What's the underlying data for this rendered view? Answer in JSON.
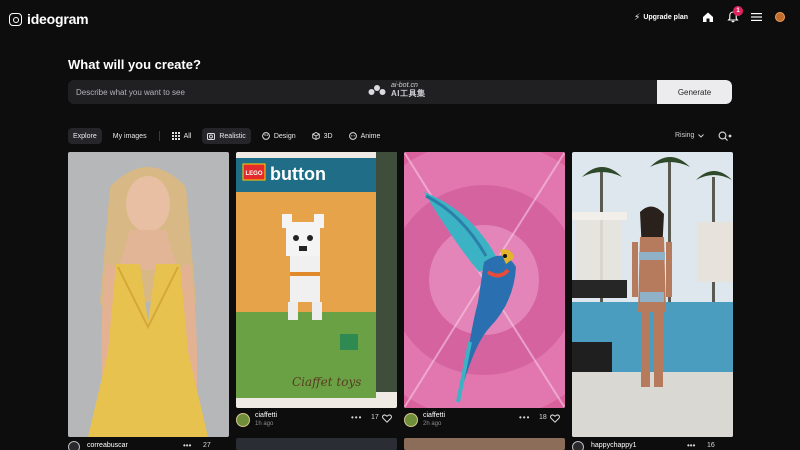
{
  "app": {
    "name": "ideogram"
  },
  "topbar": {
    "upgrade_label": "Upgrade plan",
    "notification_count": "1",
    "icons": [
      "home-icon",
      "bell-icon",
      "menu-icon",
      "avatar"
    ]
  },
  "prompt": {
    "title": "What will you create?",
    "placeholder": "Describe what you want to see",
    "generate_label": "Generate"
  },
  "watermark": {
    "line1": "ai-bot.cn",
    "line2": "AI工具集"
  },
  "filters": {
    "tabs": [
      {
        "label": "Explore",
        "active": true
      },
      {
        "label": "My images",
        "active": false
      }
    ],
    "categories": [
      {
        "label": "All",
        "icon": "grid-icon",
        "active": false
      },
      {
        "label": "Realistic",
        "icon": "camera-icon",
        "active": true
      },
      {
        "label": "Design",
        "icon": "palette-icon",
        "active": false
      },
      {
        "label": "3D",
        "icon": "cube-icon",
        "active": false
      },
      {
        "label": "Anime",
        "icon": "anime-icon",
        "active": false
      }
    ],
    "sort_label": "Rising"
  },
  "gallery": [
    {
      "user": "correabuscar",
      "time": "",
      "likes": "27",
      "image": "woman-yellow-dress"
    },
    {
      "user": "ciaffetti",
      "time": "1h ago",
      "likes": "17",
      "image": "lego-button-set"
    },
    {
      "user": "ciaffetti",
      "time": "2h ago",
      "likes": "18",
      "image": "parrot-pixel-art"
    },
    {
      "user": "happychappy1",
      "time": "",
      "likes": "16",
      "image": "woman-pool-resort"
    }
  ],
  "lego_box": {
    "brand": "LEGO",
    "title": "button",
    "age": "5+",
    "script": "Ciaffet toys"
  },
  "colors": {
    "background": "#0d0d0e",
    "accent": "#e0245e",
    "input_bg": "#202023",
    "button_bg": "#ececee"
  }
}
